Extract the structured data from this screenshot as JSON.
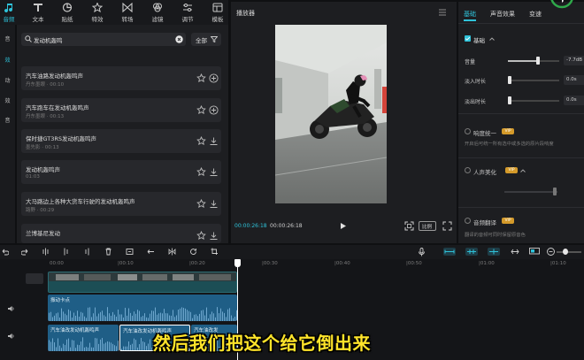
{
  "toolbar": {
    "tabs": [
      {
        "label": "音频",
        "icon": "music-note-icon"
      },
      {
        "label": "文本",
        "icon": "text-icon"
      },
      {
        "label": "贴纸",
        "icon": "sticker-icon"
      },
      {
        "label": "特效",
        "icon": "effects-star-icon"
      },
      {
        "label": "转场",
        "icon": "transition-icon"
      },
      {
        "label": "滤镜",
        "icon": "filter-icon"
      },
      {
        "label": "调节",
        "icon": "adjust-sliders-icon"
      },
      {
        "label": "模板",
        "icon": "template-icon"
      }
    ]
  },
  "rail": {
    "items": [
      "音",
      "效",
      "动",
      "效",
      "音"
    ]
  },
  "media": {
    "search_value": "发动机轰鸣",
    "filter_label": "全部",
    "items": [
      {
        "title": "汽车油路发动机轰鸣声",
        "sub": "丹东墨眼 · 00:10"
      },
      {
        "title": "汽车跑车在发动机轰鸣声",
        "sub": "丹东墨眼 · 00:13"
      },
      {
        "title": "保时捷GT3RS发动机轰鸣声",
        "sub": "墨先影 · 00:13"
      },
      {
        "title": "发动机轰鸣声",
        "sub": "01:03"
      },
      {
        "title": "大马路边上各种大货车行驶的发动机轰鸣声",
        "sub": "路野 · 00:29"
      },
      {
        "title": "兰博基尼发动",
        "sub": ""
      }
    ]
  },
  "player": {
    "title": "播放器",
    "time_current": "00:00:26:18",
    "time_total": "00:00:26:18",
    "ratio_label": "比例"
  },
  "right_panel": {
    "tabs": [
      "基础",
      "声音效果",
      "变速"
    ],
    "section_basic": "基础",
    "volume_label": "音量",
    "volume_value": "-7.7dB",
    "volume_level": 0.58,
    "fade_in_label": "淡入时长",
    "fade_in_value": "0.0s",
    "fade_out_label": "淡出时长",
    "fade_out_value": "0.0s",
    "loudness_label": "响度统一",
    "loudness_desc": "开启后可统一所有选中或多选的原片段响度",
    "enhance_label": "人声美化",
    "denoise_label": "音频翻译",
    "denoise_desc": "翻译的音频可同时保留原音色",
    "vip_badge": "VIP"
  },
  "timeline": {
    "ruler_labels": [
      "00:00",
      "|00:10",
      "|00:20",
      "|00:30",
      "|00:40",
      "|00:50",
      "|01:00",
      "|01:10"
    ],
    "clip_main_label": "",
    "clip_audio1_label": "振动卡点",
    "clip_audio2a_label": "汽车油改发动机轰鸣声",
    "clip_audio2b_label": "汽车油改发动机轰鸣声",
    "clip_audio2c_label": "汽车油改发"
  },
  "subtitle": "然后我们把这个给它倒出来",
  "colors": {
    "accent": "#2fc3da",
    "subtitle": "#ffe42a",
    "playhead": "#ffffff"
  }
}
